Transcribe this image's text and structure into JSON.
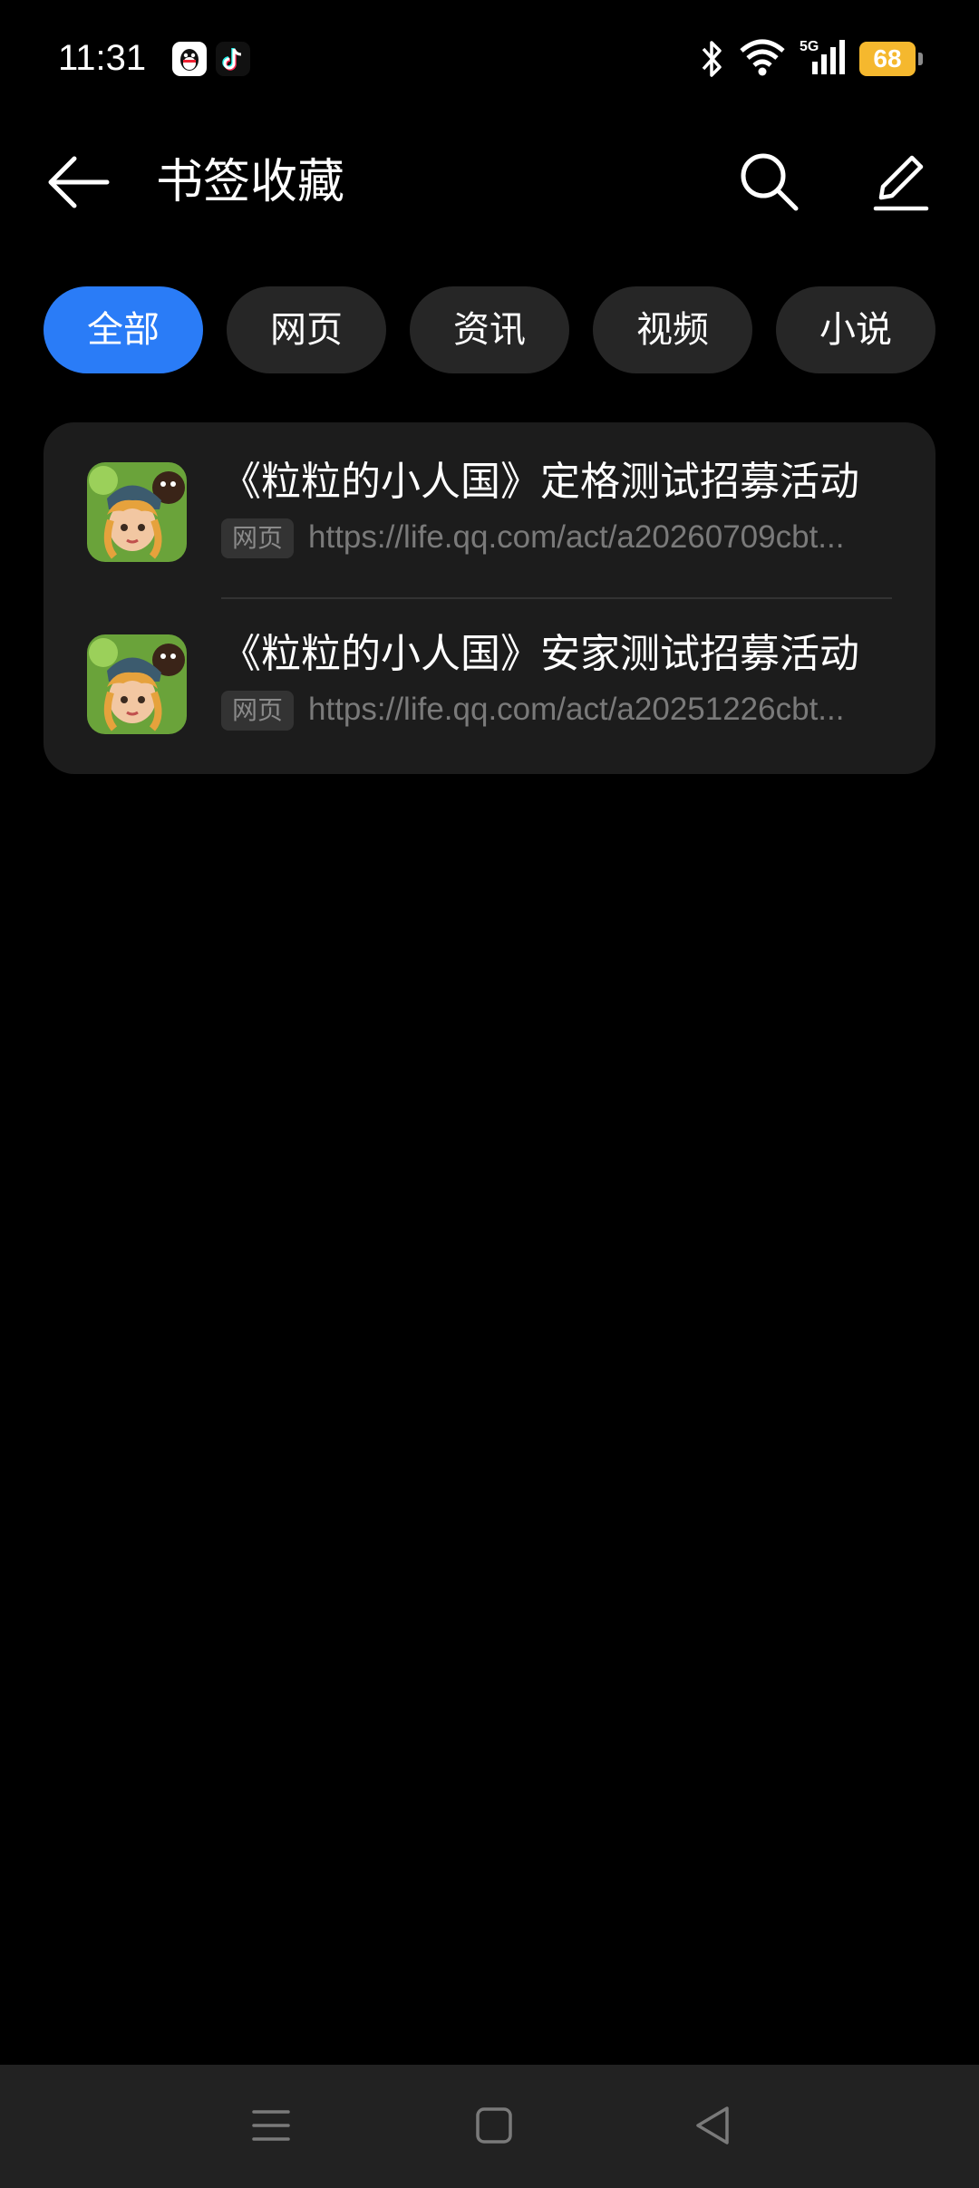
{
  "status_bar": {
    "time": "11:31",
    "network": "5G",
    "battery": "68",
    "notification_icons": [
      "qq-icon",
      "tiktok-icon"
    ],
    "system_icons": [
      "bluetooth-icon",
      "wifi-icon",
      "cellular-signal-icon",
      "battery-icon"
    ]
  },
  "header": {
    "title": "书签收藏",
    "back_icon": "back-arrow-icon",
    "search_icon": "search-icon",
    "edit_icon": "edit-pencil-icon"
  },
  "tabs": [
    {
      "label": "全部",
      "active": true
    },
    {
      "label": "网页",
      "active": false
    },
    {
      "label": "资讯",
      "active": false
    },
    {
      "label": "视频",
      "active": false
    },
    {
      "label": "小说",
      "active": false
    }
  ],
  "bookmarks": [
    {
      "title": "《粒粒的小人国》定格测试招募活动",
      "tag": "网页",
      "url": "https://life.qq.com/act/a20260709cbt..."
    },
    {
      "title": "《粒粒的小人国》安家测试招募活动",
      "tag": "网页",
      "url": "https://life.qq.com/act/a20251226cbt..."
    }
  ],
  "nav_bar": {
    "icons": [
      "menu-icon",
      "home-icon",
      "back-triangle-icon"
    ]
  },
  "colors": {
    "accent": "#2a7cf7",
    "background": "#000000",
    "card": "#1c1c1c",
    "battery": "#f5b82e"
  }
}
